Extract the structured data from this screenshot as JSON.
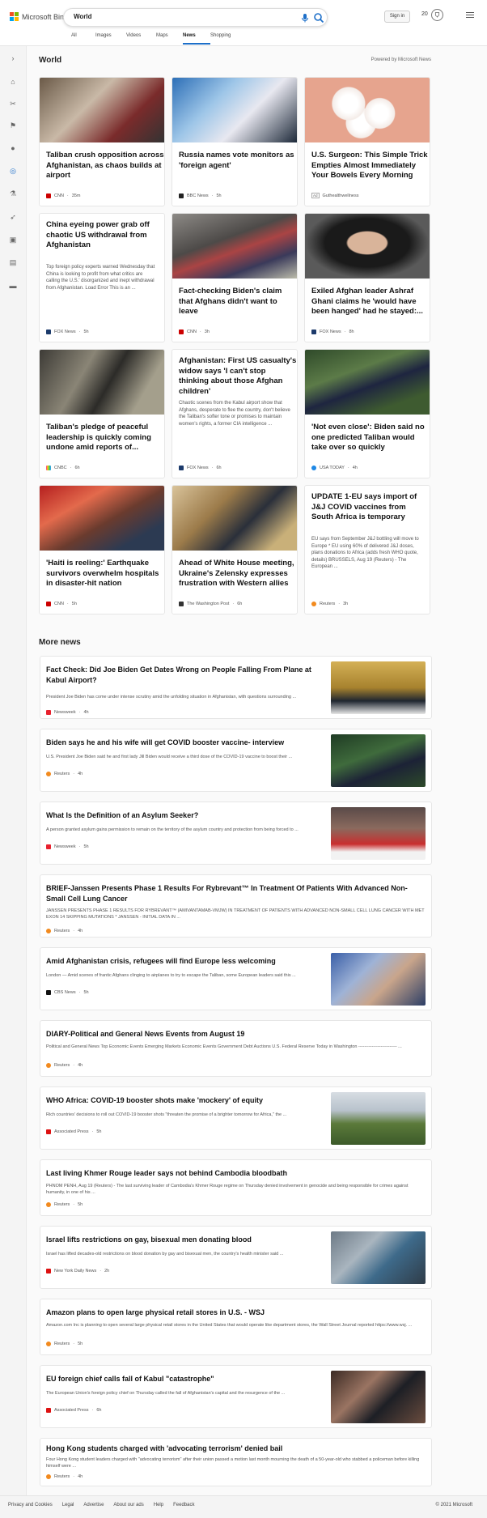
{
  "header": {
    "logo_text": "Microsoft Bing",
    "search_value": "World",
    "signin_label": "Sign in",
    "rewards_count": "20"
  },
  "tabs": [
    "All",
    "Images",
    "Videos",
    "Maps",
    "News",
    "Shopping"
  ],
  "active_tab": "News",
  "rail_icons": [
    "chevron-right-icon",
    "home-icon",
    "sports-icon",
    "flag-icon",
    "location-pin-icon",
    "globe-icon",
    "science-icon",
    "rocket-icon",
    "film-icon",
    "building-icon",
    "money-icon"
  ],
  "world": {
    "title": "World",
    "powered_by": "Powered by Microsoft News",
    "cards": [
      {
        "title": "Taliban crush opposition across Afghanistan, as chaos builds at airport",
        "snippet": "",
        "source": "CNN",
        "age": "35m",
        "ad": false
      },
      {
        "title": "Russia names vote monitors as 'foreign agent'",
        "snippet": "",
        "source": "BBC News",
        "age": "5h",
        "ad": false
      },
      {
        "title": "U.S. Surgeon: This Simple Trick Empties Almost Immediately Your Bowels Every Morning",
        "snippet": "",
        "source": "Guthealthwellness",
        "age": "",
        "ad": true
      },
      {
        "title": "China eyeing power grab off chaotic US withdrawal from Afghanistan",
        "snippet": "Top foreign policy experts warned Wednesday that China is looking to profit from what critics are calling the U.S.' disorganized and inept withdrawal from Afghanistan. Load Error This is an ...",
        "source": "FOX News",
        "age": "5h",
        "ad": false
      },
      {
        "title": "Fact-checking Biden's claim that Afghans didn't want to leave",
        "snippet": "",
        "source": "CNN",
        "age": "3h",
        "ad": false
      },
      {
        "title": "Exiled Afghan leader Ashraf Ghani claims he 'would have been hanged' had he stayed:...",
        "snippet": "",
        "source": "FOX News",
        "age": "8h",
        "ad": false
      },
      {
        "title": "Taliban's pledge of peaceful leadership is quickly coming undone amid reports of...",
        "snippet": "",
        "source": "CNBC",
        "age": "6h",
        "ad": false
      },
      {
        "title": "Afghanistan: First US casualty's widow says 'I can't stop thinking about those Afghan children'",
        "snippet": "Chaotic scenes from the Kabul airport show that Afghans, desperate to flee the country, don't believe the Taliban's softer tone or promises to maintain women's rights, a former CIA intelligence ...",
        "source": "FOX News",
        "age": "6h",
        "ad": false
      },
      {
        "title": "'Not even close': Biden said no one predicted Taliban would take over so quickly",
        "snippet": "",
        "source": "USA TODAY",
        "age": "4h",
        "ad": false
      },
      {
        "title": "'Haiti is reeling:' Earthquake survivors overwhelm hospitals in disaster-hit nation",
        "snippet": "",
        "source": "CNN",
        "age": "5h",
        "ad": false
      },
      {
        "title": "Ahead of White House meeting, Ukraine's Zelensky expresses frustration with Western allies",
        "snippet": "",
        "source": "The Washington Post",
        "age": "6h",
        "ad": false
      },
      {
        "title": "UPDATE 1-EU says import of J&J COVID vaccines from South Africa is temporary",
        "snippet": "EU says from September J&J bottling will move to Europe * EU using 60% of delivered J&J doses, plans donations to Africa (adds fresh WHO quote, details) BRUSSELS, Aug 19 (Reuters) - The European ...",
        "source": "Reuters",
        "age": "3h",
        "ad": false
      }
    ]
  },
  "more_news": {
    "title": "More news",
    "items": [
      {
        "title": "Fact Check: Did Joe Biden Get Dates Wrong on People Falling From Plane at Kabul Airport?",
        "snippet": "President Joe Biden has come under intense scrutiny amid the unfolding situation in Afghanistan, with questions surrounding ...",
        "source": "Newsweek",
        "age": "4h"
      },
      {
        "title": "Biden says he and his wife will get COVID booster vaccine- interview",
        "snippet": "U.S. President Joe Biden said he and first lady Jill Biden would receive a third dose of the COVID-19 vaccine to boost their ...",
        "source": "Reuters",
        "age": "4h"
      },
      {
        "title": "What Is the Definition of an Asylum Seeker?",
        "snippet": "A person granted asylum gains permission to remain on the territory of the asylum country and protection from being forced to ...",
        "source": "Newsweek",
        "age": "5h"
      },
      {
        "title": "BRIEF-Janssen Presents Phase 1 Results For Rybrevant™ In Treatment Of Patients With Advanced Non-Small Cell Lung Cancer",
        "snippet": "JANSSEN PRESENTS PHASE 1 RESULTS FOR RYBREVANT™ (AMIVANTAMAB-VMJW) IN TREATMENT OF PATIENTS WITH ADVANCED NON-SMALL CELL LUNG CANCER WITH MET EXON 14 SKIPPING MUTATIONS * JANSSEN - INITIAL DATA IN ...",
        "source": "Reuters",
        "age": "4h"
      },
      {
        "title": "Amid Afghanistan crisis, refugees will find Europe less welcoming",
        "snippet": "London — Amid scenes of frantic Afghans clinging to airplanes to try to escape the Taliban, some European leaders said this ...",
        "source": "CBS News",
        "age": "5h"
      },
      {
        "title": "DIARY-Political and General News Events from August 19",
        "snippet": "Political and General News Top Economic Events Emerging Markets Economic Events Government Debt Auctions U.S. Federal Reserve Today in Washington -------------------------- ...",
        "source": "Reuters",
        "age": "4h"
      },
      {
        "title": "WHO Africa: COVID-19 booster shots make 'mockery' of equity",
        "snippet": "Rich countries' decisions to roll out COVID-19 booster shots \"threaten the promise of a brighter tomorrow for Africa,\" the ...",
        "source": "Associated Press",
        "age": "5h"
      },
      {
        "title": "Last living Khmer Rouge leader says not behind Cambodia bloodbath",
        "snippet": "PHNOM PENH, Aug 19 (Reuters) - The last surviving leader of Cambodia's Khmer Rouge regime on Thursday denied involvement in genocide and being responsible for crimes against humanity, in one of his ...",
        "source": "Reuters",
        "age": "5h"
      },
      {
        "title": "Israel lifts restrictions on gay, bisexual men donating blood",
        "snippet": "Israel has lifted decades-old restrictions on blood donation by gay and bisexual men, the country's health minister said ...",
        "source": "New York Daily News",
        "age": "2h"
      },
      {
        "title": "Amazon plans to open large physical retail stores in U.S. - WSJ",
        "snippet": "Amazon.com Inc is planning to open several large physical retail stores in the United States that would operate like department stores, the Wall Street Journal reported https://www.wsj. ...",
        "source": "Reuters",
        "age": "5h"
      },
      {
        "title": "EU foreign chief calls fall of Kabul \"catastrophe\"",
        "snippet": "The European Union's foreign policy chief on Thursday called the fall of Afghanistan's capital and the resurgence of the ...",
        "source": "Associated Press",
        "age": "6h"
      },
      {
        "title": "Hong Kong students charged with 'advocating terrorism' denied bail",
        "snippet": "Four Hong Kong student leaders charged with \"advocating terrorism\" after their union passed a motion last month mourning the death of a 50-year-old who stabbed a policeman before killing himself were ...",
        "source": "Reuters",
        "age": "4h"
      }
    ]
  },
  "footer": {
    "links": [
      "Privacy and Cookies",
      "Legal",
      "Advertise",
      "About our ads",
      "Help",
      "Feedback"
    ],
    "copyright": "© 2021 Microsoft"
  }
}
